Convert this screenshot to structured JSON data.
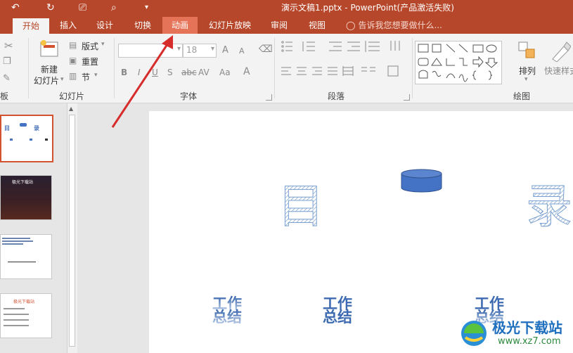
{
  "title_bar": {
    "title": "演示文稿1.pptx - PowerPoint(产品激活失败)",
    "qa_undo": "↶",
    "qa_redo": "↻",
    "qa_present": "⎚",
    "qa_preview": "⌕",
    "qa_more": "▾"
  },
  "tabs": [
    {
      "label": "开始"
    },
    {
      "label": "插入"
    },
    {
      "label": "设计"
    },
    {
      "label": "切换"
    },
    {
      "label": "动画"
    },
    {
      "label": "幻灯片放映"
    },
    {
      "label": "审阅"
    },
    {
      "label": "视图"
    }
  ],
  "tell_me": "告诉我您想要做什么...",
  "ribbon": {
    "clipboard_label": "板",
    "slides": {
      "new_slide_line1": "新建",
      "new_slide_line2": "幻灯片",
      "layout": "版式",
      "reset": "重置",
      "section": "节",
      "group_label": "幻灯片"
    },
    "font": {
      "size_value": "18",
      "group_label": "字体",
      "bold": "B",
      "italic": "I",
      "underline": "U",
      "shadow": "S",
      "strike": "abc",
      "spacing": "AV",
      "case": "Aa",
      "color": "A",
      "grow": "A",
      "shrink": "A"
    },
    "paragraph": {
      "group_label": "段落"
    },
    "drawing": {
      "arrange": "排列",
      "quick_styles": "快速样式",
      "group_label": "绘图"
    }
  },
  "slide": {
    "char_mu": "目",
    "char_lu": "录",
    "item1_line1": "工作",
    "item1_line2": "总结",
    "item2_line1": "工作",
    "item2_line2": "总结",
    "item3_line1": "工作",
    "item3_line2": "总结"
  },
  "thumbnails": {
    "t1_a": "目",
    "t1_b": "录",
    "t2_title": "极光下载站",
    "t4_title": "极光下载站"
  },
  "watermark": {
    "name": "极光下载站",
    "url": "www.xz7.com"
  },
  "colors": {
    "brand": "#b7472a",
    "tab_hover": "#e57357",
    "annotation_arrow": "#d62c2c",
    "slide_text": "#4a74b8",
    "cylinder": "#4472c4"
  }
}
